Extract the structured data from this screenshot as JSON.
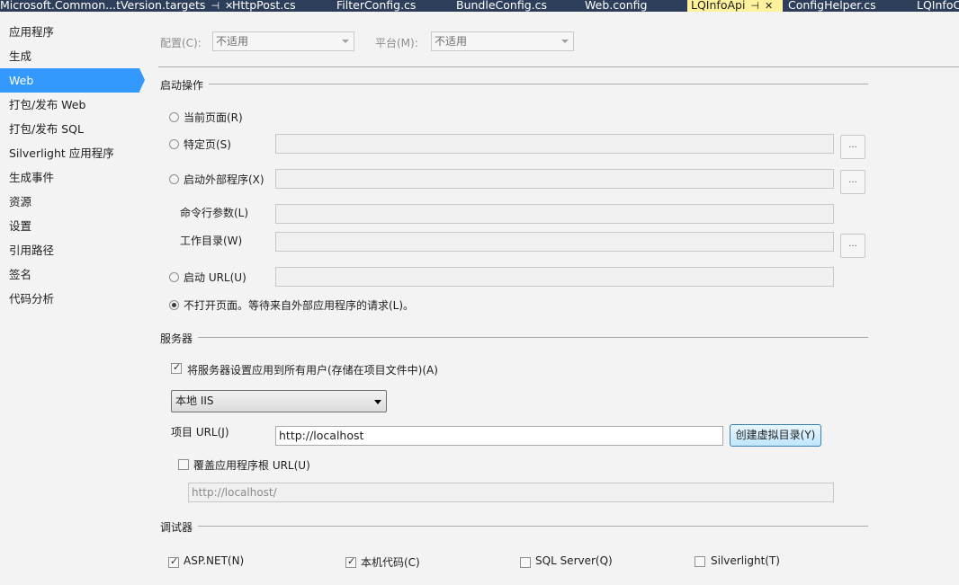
{
  "tabs": [
    {
      "label": "Microsoft.Common...tVersion.targets",
      "pin": "⊣",
      "close": "✕"
    },
    {
      "label": "HttpPost.cs"
    },
    {
      "label": "FilterConfig.cs"
    },
    {
      "label": "BundleConfig.cs"
    },
    {
      "label": "Web.config"
    },
    {
      "label": "LQInfoApi",
      "pin": "⊣",
      "close": "✕"
    },
    {
      "label": "ConfigHelper.cs"
    },
    {
      "label": "LQInfoC"
    }
  ],
  "sidebar": {
    "items": [
      {
        "label": "应用程序"
      },
      {
        "label": "生成"
      },
      {
        "label": "Web"
      },
      {
        "label": "打包/发布 Web"
      },
      {
        "label": "打包/发布 SQL"
      },
      {
        "label": "Silverlight 应用程序"
      },
      {
        "label": "生成事件"
      },
      {
        "label": "资源"
      },
      {
        "label": "设置"
      },
      {
        "label": "引用路径"
      },
      {
        "label": "签名"
      },
      {
        "label": "代码分析"
      }
    ],
    "active_index": 2
  },
  "config": {
    "config_label": "配置(C):",
    "config_value": "不适用",
    "platform_label": "平台(M):",
    "platform_value": "不适用"
  },
  "start_action": {
    "title": "启动操作",
    "current_page": "当前页面(R)",
    "specific_page": "特定页(S)",
    "external_program": "启动外部程序(X)",
    "cmd_args": "命令行参数(L)",
    "working_dir": "工作目录(W)",
    "start_url": "启动 URL(U)",
    "dont_open": "不打开页面。等待来自外部应用程序的请求(L)。",
    "ellipsis": "..."
  },
  "servers": {
    "title": "服务器",
    "apply_all": "将服务器设置应用到所有用户(存储在项目文件中)(A)",
    "server_type": "本地 IIS",
    "project_url_label": "项目 URL(J)",
    "project_url_value": "http://localhost",
    "create_vdir_button": "创建虚拟目录(Y)",
    "override_root": "覆盖应用程序根 URL(U)",
    "override_value": "http://localhost/"
  },
  "debuggers": {
    "title": "调试器",
    "aspnet": "ASP.NET(N)",
    "native": "本机代码(C)",
    "sql": "SQL Server(Q)",
    "silverlight": "Silverlight(T)"
  },
  "checkmark": "✓",
  "colors": {
    "tab_bg": "#2d3e5a",
    "active_tab": "#fff29d",
    "accent": "#3399ff"
  }
}
